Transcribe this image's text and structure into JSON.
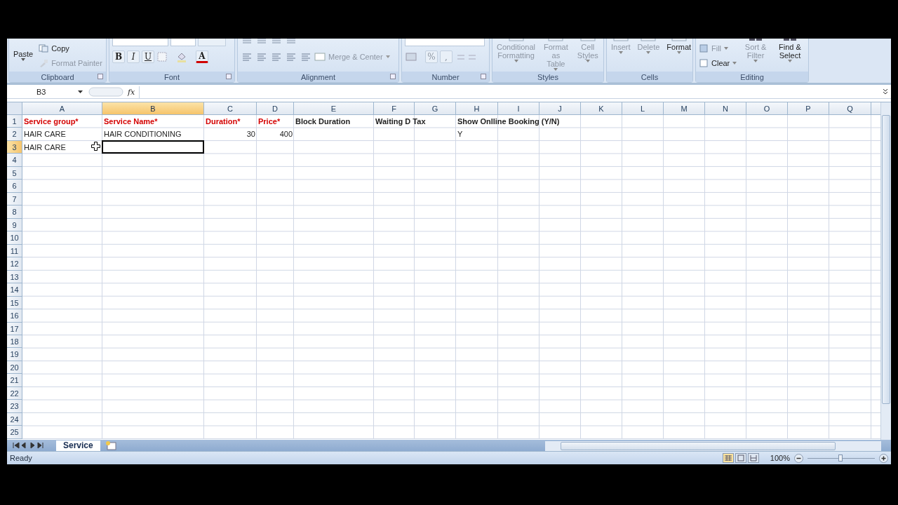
{
  "ribbon": {
    "groups": [
      {
        "kind": "clipboard",
        "label": "Clipboard",
        "paste": "Paste",
        "items": [
          {
            "label": "Copy",
            "disabled": false
          },
          {
            "label": "Format Painter",
            "disabled": true
          }
        ]
      },
      {
        "kind": "font",
        "label": "Font",
        "styles": [
          "B",
          "I",
          "U"
        ],
        "color_button": "A"
      },
      {
        "kind": "alignment",
        "label": "Alignment",
        "merge": {
          "label": "Merge & Center",
          "disabled": true
        }
      },
      {
        "kind": "number",
        "label": "Number",
        "percent": "%",
        "comma": ","
      },
      {
        "kind": "styles",
        "label": "Styles",
        "buttons": [
          {
            "label": "Conditional Formatting",
            "disabled": true
          },
          {
            "label": "Format as Table",
            "disabled": true
          },
          {
            "label": "Cell Styles",
            "disabled": true
          }
        ]
      },
      {
        "kind": "cells",
        "label": "Cells",
        "buttons": [
          {
            "label": "Insert",
            "disabled": true
          },
          {
            "label": "Delete",
            "disabled": true
          },
          {
            "label": "Format",
            "disabled": false
          }
        ]
      },
      {
        "kind": "editing",
        "label": "Editing",
        "small": [
          {
            "label": "Fill",
            "disabled": true
          },
          {
            "label": "Clear",
            "disabled": false
          }
        ],
        "buttons": [
          {
            "label": "Sort & Filter",
            "disabled": true
          },
          {
            "label": "Find & Select",
            "disabled": false
          }
        ]
      }
    ]
  },
  "formula_bar": {
    "name_box": "B3",
    "fx": "fx"
  },
  "sheet": {
    "columns": [
      {
        "label": "A",
        "selected": false
      },
      {
        "label": "B",
        "selected": true
      },
      {
        "label": "C",
        "selected": false
      },
      {
        "label": "D",
        "selected": false
      },
      {
        "label": "E",
        "selected": false
      },
      {
        "label": "F",
        "selected": false
      },
      {
        "label": "G",
        "selected": false
      },
      {
        "label": "H",
        "selected": false
      },
      {
        "label": "I",
        "selected": false
      },
      {
        "label": "J",
        "selected": false
      },
      {
        "label": "K",
        "selected": false
      },
      {
        "label": "L",
        "selected": false
      },
      {
        "label": "M",
        "selected": false
      },
      {
        "label": "N",
        "selected": false
      },
      {
        "label": "O",
        "selected": false
      },
      {
        "label": "P",
        "selected": false
      },
      {
        "label": "Q",
        "selected": false
      }
    ],
    "rows": [
      {
        "number": "1",
        "selected": false,
        "cells": [
          {
            "text": "Service group*",
            "kind": "header",
            "required": true
          },
          {
            "text": "Service Name*",
            "kind": "header",
            "required": true
          },
          {
            "text": "Duration*",
            "kind": "header",
            "required": true
          },
          {
            "text": "Price*",
            "kind": "header",
            "required": true
          },
          {
            "text": "Block Duration",
            "kind": "header",
            "required": false
          },
          {
            "text": "Waiting D Tax",
            "kind": "header",
            "required": false
          },
          null,
          {
            "text": "Show Onlline Booking (Y/N)",
            "kind": "header",
            "required": false
          },
          null,
          null,
          null,
          null,
          null,
          null,
          null,
          null,
          null
        ]
      },
      {
        "number": "2",
        "selected": false,
        "cells": [
          {
            "text": "HAIR CARE",
            "kind": "text"
          },
          {
            "text": "HAIR CONDITIONING",
            "kind": "text"
          },
          {
            "text": "30",
            "kind": "number"
          },
          {
            "text": "400",
            "kind": "number"
          },
          null,
          null,
          null,
          {
            "text": "Y",
            "kind": "text"
          },
          null,
          null,
          null,
          null,
          null,
          null,
          null,
          null,
          null
        ]
      },
      {
        "number": "3",
        "selected": true,
        "cells": [
          {
            "text": "HAIR CARE",
            "kind": "text"
          },
          {
            "active": true
          },
          null,
          null,
          null,
          null,
          null,
          null,
          null,
          null,
          null,
          null,
          null,
          null,
          null,
          null,
          null
        ]
      },
      {
        "number": "4",
        "selected": false
      },
      {
        "number": "5",
        "selected": false
      },
      {
        "number": "6",
        "selected": false
      },
      {
        "number": "7",
        "selected": false
      },
      {
        "number": "8",
        "selected": false
      },
      {
        "number": "9",
        "selected": false
      },
      {
        "number": "10",
        "selected": false
      },
      {
        "number": "11",
        "selected": false
      },
      {
        "number": "12",
        "selected": false
      },
      {
        "number": "13",
        "selected": false
      },
      {
        "number": "14",
        "selected": false
      },
      {
        "number": "15",
        "selected": false
      },
      {
        "number": "16",
        "selected": false
      },
      {
        "number": "17",
        "selected": false
      },
      {
        "number": "18",
        "selected": false
      },
      {
        "number": "19",
        "selected": false
      },
      {
        "number": "20",
        "selected": false
      },
      {
        "number": "21",
        "selected": false
      },
      {
        "number": "22",
        "selected": false
      },
      {
        "number": "23",
        "selected": false
      },
      {
        "number": "24",
        "selected": false
      },
      {
        "number": "25",
        "selected": false
      }
    ]
  },
  "sheet_tabs": [
    {
      "label": "Service",
      "selected": true
    }
  ],
  "status_bar": {
    "status": "Ready",
    "views": [
      {
        "kind": "normal",
        "selected": true
      },
      {
        "kind": "layout",
        "selected": false
      },
      {
        "kind": "pagebreak",
        "selected": false
      }
    ],
    "zoom": "100%",
    "zoom_slider": {
      "level": 0.49
    }
  }
}
